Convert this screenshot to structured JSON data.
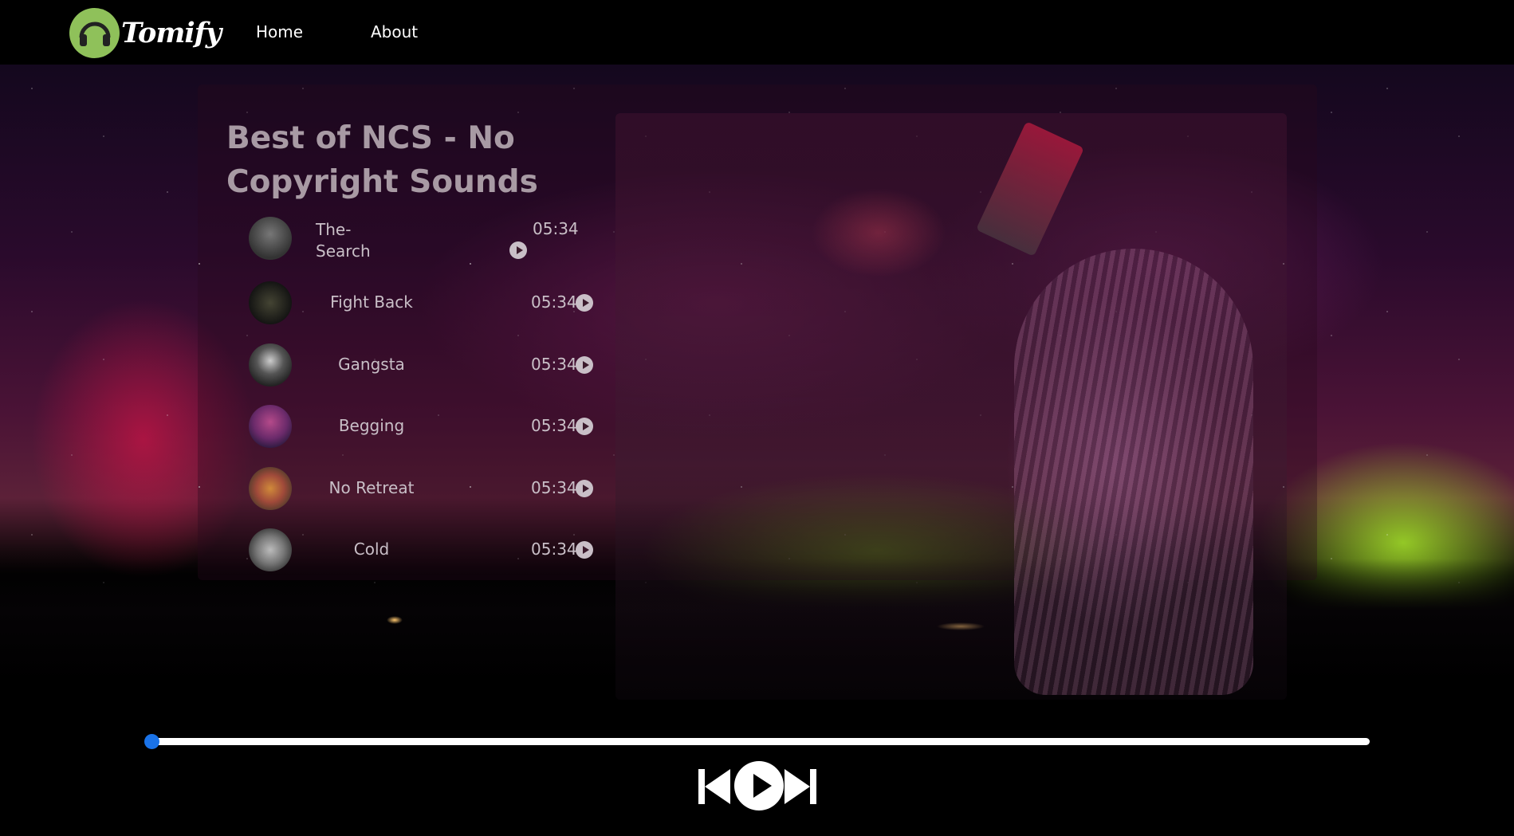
{
  "nav": {
    "logo_text": "Tomify",
    "home_label": "Home",
    "about_label": "About"
  },
  "playlist": {
    "title": "Best of NCS - No Copyright Sounds",
    "songs": [
      {
        "name": "The-Search",
        "duration": "05:34"
      },
      {
        "name": "Fight Back",
        "duration": "05:34"
      },
      {
        "name": "Gangsta",
        "duration": "05:34"
      },
      {
        "name": "Begging",
        "duration": "05:34"
      },
      {
        "name": "No Retreat",
        "duration": "05:34"
      },
      {
        "name": "Cold",
        "duration": "05:34"
      }
    ]
  },
  "player": {
    "progress": 0,
    "accent_color": "#1a73e8",
    "controls": [
      "previous-icon",
      "play-icon",
      "next-icon"
    ]
  },
  "colors": {
    "logo_green": "#8fc15a",
    "navbar_bg": "#000000"
  }
}
